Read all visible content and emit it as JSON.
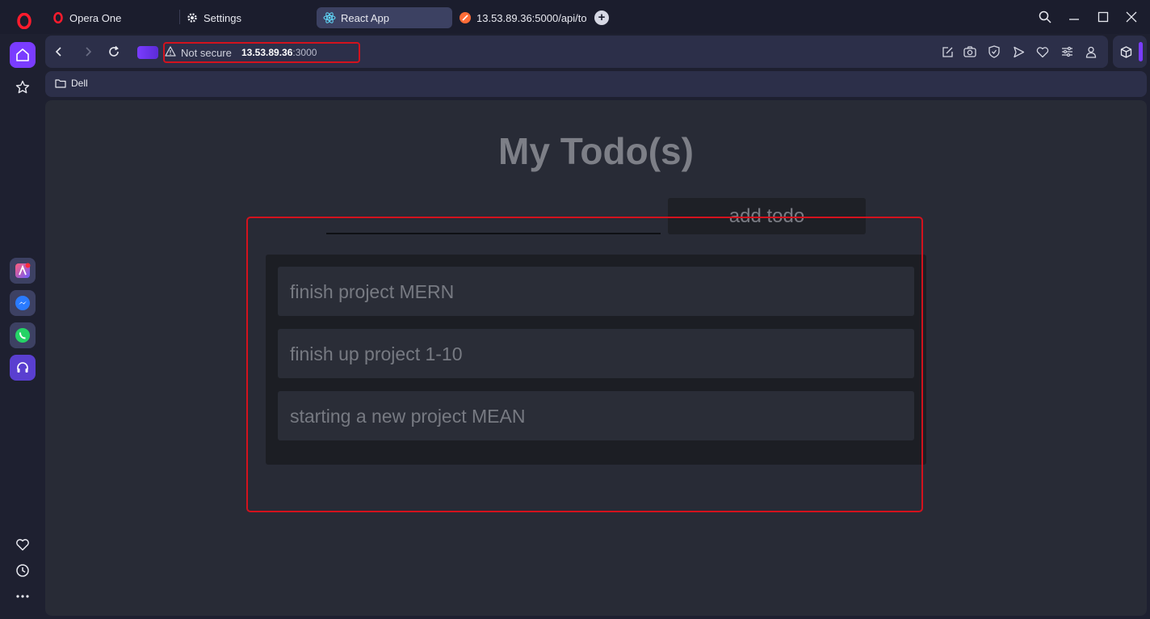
{
  "browser": {
    "tabs": [
      {
        "label": "Opera One",
        "icon": "opera-logo-icon"
      },
      {
        "label": "Settings",
        "icon": "gear-icon"
      },
      {
        "label": "React App",
        "icon": "react-logo-icon",
        "active": true
      },
      {
        "label": "13.53.89.36:5000/api/todo",
        "icon": "postman-icon"
      }
    ],
    "address": {
      "security_label": "Not secure",
      "host": "13.53.89.36",
      "port": ":3000"
    },
    "bookmarks": [
      {
        "label": "Dell",
        "icon": "folder-icon"
      }
    ],
    "colors": {
      "accent": "#7a3cff",
      "highlight": "#d3121d",
      "background": "#1e2030"
    }
  },
  "sidebar": {
    "items": [
      {
        "name": "home-icon"
      },
      {
        "name": "star-icon"
      },
      {
        "name": "aria-icon"
      },
      {
        "name": "messenger-icon"
      },
      {
        "name": "whatsapp-icon"
      },
      {
        "name": "music-player-icon"
      },
      {
        "name": "heart-icon"
      },
      {
        "name": "history-icon"
      },
      {
        "name": "more-icon"
      }
    ]
  },
  "page": {
    "title": "My Todo(s)",
    "input_value": "",
    "add_button": "add todo",
    "todos": [
      "finish project MERN",
      "finish up project 1-10",
      "starting a new project MEAN"
    ]
  }
}
